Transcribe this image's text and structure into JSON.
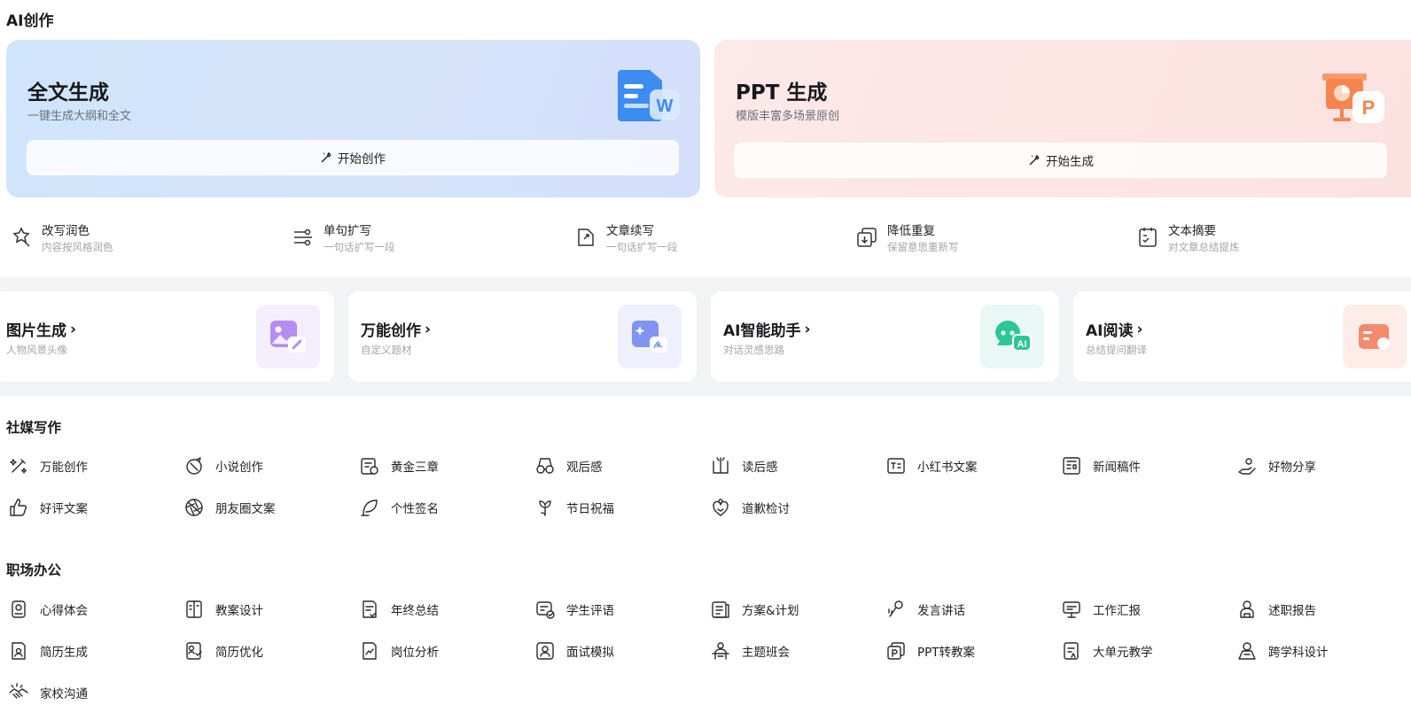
{
  "sections": {
    "ai_create": "AI创作",
    "social": "社媒写作",
    "office": "职场办公"
  },
  "hero": [
    {
      "title": "全文生成",
      "subtitle": "一键生成大纲和全文",
      "button": "开始创作"
    },
    {
      "title": "PPT 生成",
      "subtitle": "模版丰富多场景原创",
      "button": "开始生成"
    }
  ],
  "tools": [
    {
      "title": "改写润色",
      "subtitle": "内容按风格润色",
      "icon": "polish-icon"
    },
    {
      "title": "单句扩写",
      "subtitle": "一句话扩写一段",
      "icon": "expand-icon"
    },
    {
      "title": "文章续写",
      "subtitle": "一句话扩写一段",
      "icon": "continue-icon"
    },
    {
      "title": "降低重复",
      "subtitle": "保留意思重新写",
      "icon": "dedupe-icon"
    },
    {
      "title": "文本摘要",
      "subtitle": "对文章总结提炼",
      "icon": "summary-icon"
    }
  ],
  "features": [
    {
      "title": "图片生成",
      "subtitle": "人物风景头像",
      "icon": "image-gen-icon"
    },
    {
      "title": "万能创作",
      "subtitle": "自定义题材",
      "icon": "universal-create-icon"
    },
    {
      "title": "AI智能助手",
      "subtitle": "对话灵感思路",
      "icon": "ai-assistant-icon"
    },
    {
      "title": "AI阅读",
      "subtitle": "总结提问翻译",
      "icon": "ai-reading-icon"
    }
  ],
  "social_items": [
    {
      "label": "万能创作",
      "icon": "magic-icon"
    },
    {
      "label": "小说创作",
      "icon": "novel-icon"
    },
    {
      "label": "黄金三章",
      "icon": "gold-chapters-icon"
    },
    {
      "label": "观后感",
      "icon": "glasses-icon"
    },
    {
      "label": "读后感",
      "icon": "book-icon"
    },
    {
      "label": "小红书文案",
      "icon": "note-icon"
    },
    {
      "label": "新闻稿件",
      "icon": "news-icon"
    },
    {
      "label": "好物分享",
      "icon": "share-icon"
    },
    {
      "label": "好评文案",
      "icon": "thumbs-up-icon"
    },
    {
      "label": "朋友圈文案",
      "icon": "aperture-icon"
    },
    {
      "label": "个性签名",
      "icon": "feather-icon"
    },
    {
      "label": "节日祝福",
      "icon": "flower-icon"
    },
    {
      "label": "道歉检讨",
      "icon": "apology-icon"
    }
  ],
  "office_items": [
    {
      "label": "心得体会",
      "icon": "insight-icon"
    },
    {
      "label": "教案设计",
      "icon": "lesson-plan-icon"
    },
    {
      "label": "年终总结",
      "icon": "year-summary-icon"
    },
    {
      "label": "学生评语",
      "icon": "comment-icon"
    },
    {
      "label": "方案&计划",
      "icon": "plan-icon"
    },
    {
      "label": "发言讲话",
      "icon": "microphone-icon"
    },
    {
      "label": "工作汇报",
      "icon": "report-icon"
    },
    {
      "label": "述职报告",
      "icon": "duty-report-icon"
    },
    {
      "label": "简历生成",
      "icon": "resume-icon"
    },
    {
      "label": "简历优化",
      "icon": "resume-optimize-icon"
    },
    {
      "label": "岗位分析",
      "icon": "position-analysis-icon"
    },
    {
      "label": "面试模拟",
      "icon": "interview-icon"
    },
    {
      "label": "主题班会",
      "icon": "class-meeting-icon"
    },
    {
      "label": "PPT转教案",
      "icon": "ppt-to-lesson-icon"
    },
    {
      "label": "大单元教学",
      "icon": "unit-teaching-icon"
    },
    {
      "label": "跨学科设计",
      "icon": "interdisciplinary-icon"
    },
    {
      "label": "家校沟通",
      "icon": "handshake-icon"
    }
  ],
  "colors": {
    "blue_card": "#d3e3fb",
    "red_card": "#fde6e4",
    "band": "#f2f3f5"
  }
}
